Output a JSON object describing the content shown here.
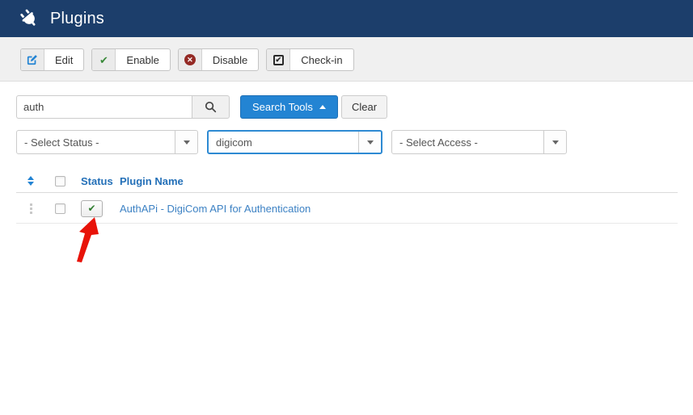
{
  "titlebar": {
    "title": "Plugins",
    "icon": "plug-icon",
    "bg_color": "#1c3e6b"
  },
  "toolbar": {
    "buttons": [
      {
        "label": "Edit",
        "icon": "edit-icon"
      },
      {
        "label": "Enable",
        "icon": "check-icon"
      },
      {
        "label": "Disable",
        "icon": "cancel-circle-icon"
      },
      {
        "label": "Check-in",
        "icon": "checkbox-checked-icon"
      }
    ]
  },
  "search": {
    "value": "auth",
    "button_icon": "magnifier-icon",
    "tools_label": "Search Tools",
    "tools_caret": "caret-up",
    "clear_label": "Clear"
  },
  "filters": {
    "status_selected": "- Select Status -",
    "extension_search_value": "digicom",
    "access_selected": "- Select Access -"
  },
  "table": {
    "sort_icon": "sort-updown-icon",
    "columns": {
      "status": "Status",
      "plugin_name": "Plugin Name"
    },
    "rows": [
      {
        "plugin_name": "AuthAPi - DigiCom API for Authentication",
        "status": "enabled",
        "status_icon": "check-icon",
        "drag_icon": "drag-dots-icon"
      }
    ]
  },
  "annotation": {
    "type": "red-arrow pointing at enabled status toggle",
    "color": "#e81309"
  },
  "glyphs": {
    "check": "✔",
    "cross": "✕"
  },
  "colors": {
    "header_bg": "#1c3e6b",
    "primary_blue": "#2384d3",
    "link_blue": "#3d82c4",
    "column_header_blue": "#2470b8",
    "enable_green": "#3a8a3a",
    "disable_red": "#942a25",
    "toolbar_bg": "#f0f0f0"
  }
}
